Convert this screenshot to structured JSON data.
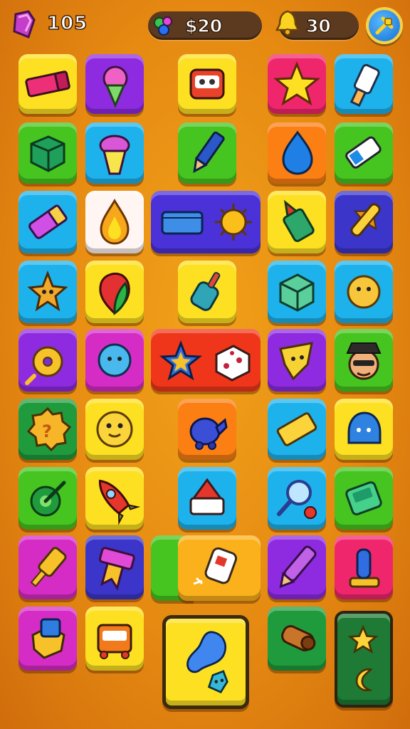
{
  "hud": {
    "gems": "105",
    "money": "$20",
    "bells": "30"
  },
  "colors": {
    "background": "#e68a12",
    "hud_pill": "#5b3a1f",
    "yellow": "#fde022",
    "purple": "#8e2be0",
    "blue": "#1eb2ec",
    "green": "#46c41f",
    "pink": "#f0266d",
    "orange": "#fb7f12"
  },
  "icons": [
    "gem-icon",
    "gems-cluster-icon",
    "bell-icon",
    "settings-icon",
    "eraser-icon",
    "ice-cream-icon",
    "robot-head-icon",
    "star-icon",
    "gadget-icon",
    "cube-icon",
    "cupcake-icon",
    "pencil-icon",
    "blue-drop-icon",
    "battery-icon",
    "crayon-icon",
    "fire-drop-icon",
    "blue-block-icon",
    "spiky-ball-icon",
    "glue-icon",
    "rocket-pen-icon",
    "starfish-icon",
    "leaf-drop-icon",
    "marker-icon",
    "green-cube-icon",
    "yellow-puff-icon",
    "donut-icon",
    "blue-puff-icon",
    "star-dice-icon",
    "yellow-flag-icon",
    "face-hat-icon",
    "puzzle-badge-icon",
    "smiley-icon",
    "blue-elephant-icon",
    "yellow-block-icon",
    "blue-helmet-icon",
    "target-icon",
    "rocket-icon",
    "red-gem-cube-icon",
    "magnifier-icon",
    "handheld-console-icon",
    "usb-stick-icon",
    "bookmark-icon",
    "paper-roll-icon",
    "purple-pencil-icon",
    "joystick-icon",
    "blue-bag-icon",
    "orange-robot-icon",
    "jelly-drop-icon",
    "wooden-cannon-icon",
    "star-moon-icon"
  ]
}
